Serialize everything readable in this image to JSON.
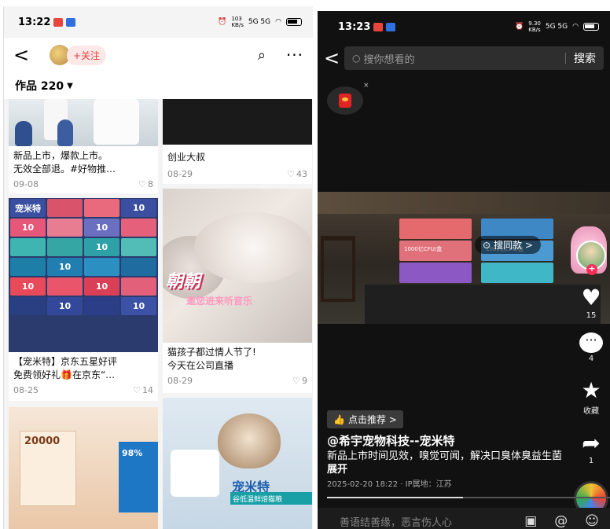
{
  "left": {
    "status": {
      "time": "13:22",
      "net_speed": "103\nKB/s",
      "signal": "5G 5G"
    },
    "nav": {
      "back_glyph": "<",
      "follow_label": "+关注",
      "search_glyph": "⌕",
      "more_glyph": "···"
    },
    "works_label": "作品 220",
    "cards": [
      {
        "caption": "新品上市，爆款上市。\n无效全部退。#好物推…",
        "date": "09-08",
        "likes": "8"
      },
      {
        "caption": "创业大叔",
        "date": "08-29",
        "likes": "43"
      },
      {
        "caption": "【宠米特】京东五星好评\n免费领好礼🎁在京东“…",
        "date": "08-25",
        "likes": "14",
        "box_number": "10"
      },
      {
        "caption": "猫孩子都过情人节了!\n今天在公司直播",
        "date": "08-29",
        "likes": "9",
        "overlay_big": "朝朝",
        "overlay_sub": "邀您进来听音乐"
      },
      {
        "poster_number": "20000",
        "poster_pct": "98%"
      },
      {
        "brand_text": "宠米特",
        "band_text": "谷低温鲜焙猫粮"
      }
    ]
  },
  "right": {
    "status": {
      "time": "13:23",
      "net_speed": "9.30\nKB/s",
      "signal": "5G 5G"
    },
    "search": {
      "placeholder": "搜你想看的",
      "button": "搜索"
    },
    "find_same_label": "搜同款 >",
    "video_label": "1000亿CFU/盒",
    "side": {
      "likes": "15",
      "comments": "4",
      "favorite_label": "收藏",
      "shares": "1"
    },
    "recommend_label": "点击推荐 >",
    "handle": "@希宇宠物科技--宠米特",
    "description": "新品上市时间见效，嗅觉可闻，解决口臭体臭益生菌",
    "expand_label": "展开",
    "time_ip": "2025-02-20 18:22 · IP属地：江苏",
    "comment_placeholder": "善语结善缘，恶言伤人心",
    "progress": 0.48
  },
  "colors": {
    "accent_red": "#fe2c55",
    "follow_red": "#e23b3b"
  }
}
